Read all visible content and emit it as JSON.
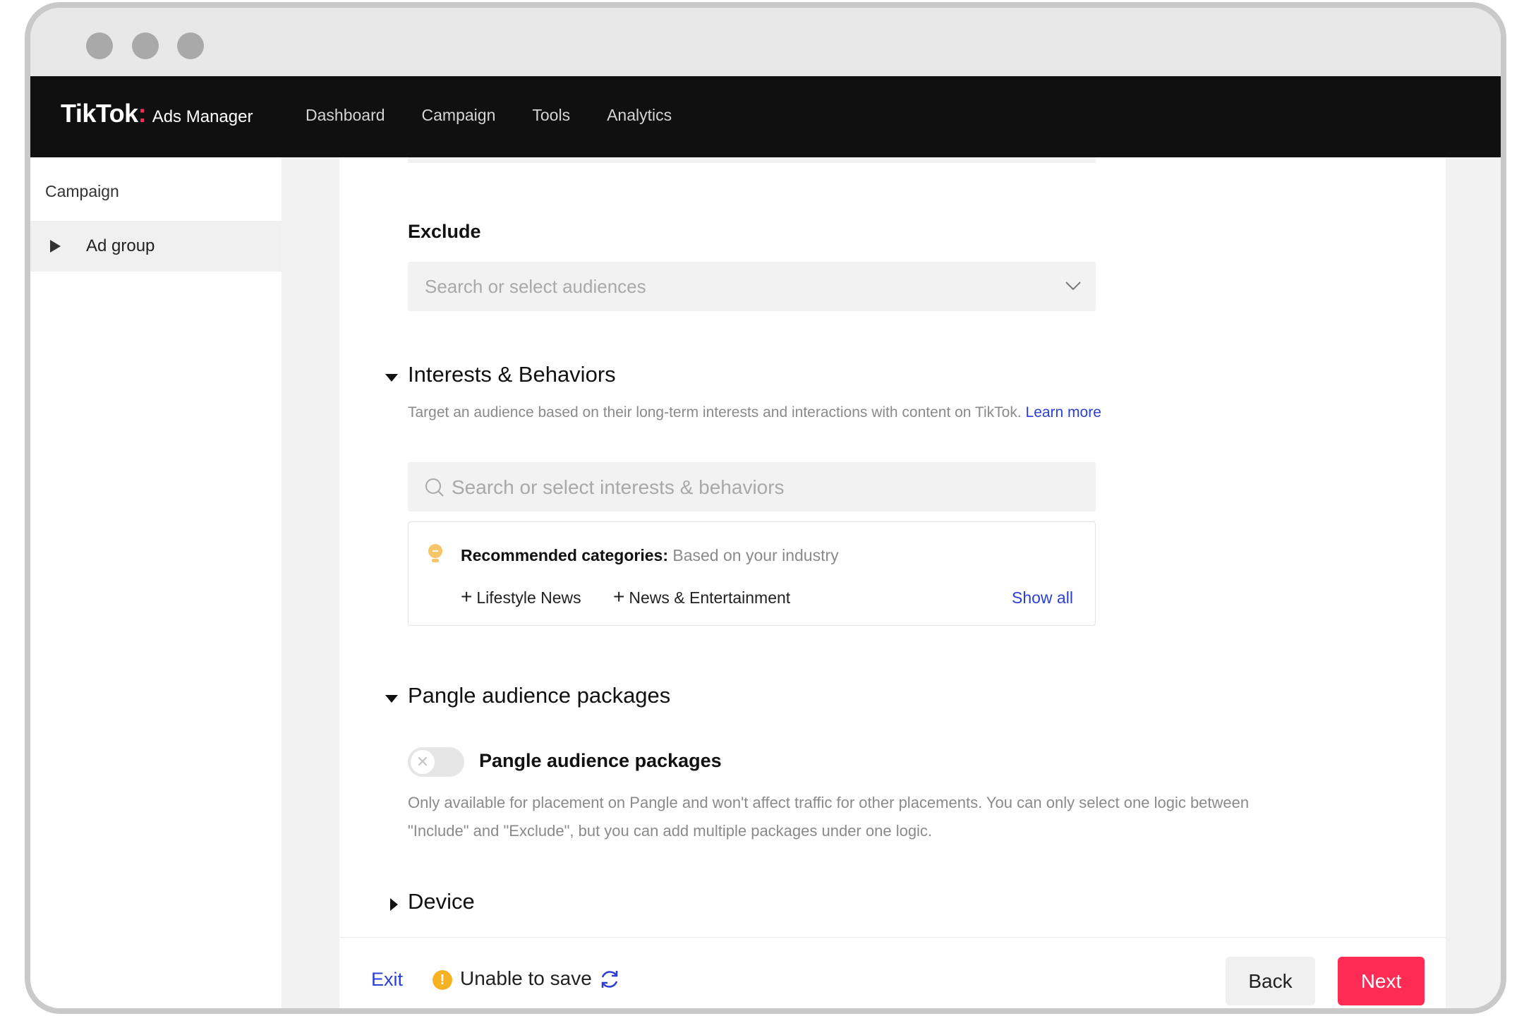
{
  "app": {
    "logo_main": "TikTok",
    "logo_colon": ":",
    "logo_sub": "Ads Manager"
  },
  "nav": {
    "items": [
      {
        "label": "Dashboard"
      },
      {
        "label": "Campaign"
      },
      {
        "label": "Tools"
      },
      {
        "label": "Analytics"
      }
    ]
  },
  "sidebar": {
    "campaign_label": "Campaign",
    "adgroup_label": "Ad group"
  },
  "exclude": {
    "label": "Exclude",
    "placeholder": "Search or select audiences"
  },
  "interests": {
    "title": "Interests & Behaviors",
    "description": "Target an audience based on their long-term interests and interactions with content on TikTok.",
    "learn_more": "Learn more",
    "search_placeholder": "Search or select interests & behaviors",
    "recommended_label": "Recommended categories:",
    "recommended_sub": "Based on your industry",
    "categories": [
      {
        "label": "Lifestyle News"
      },
      {
        "label": "News & Entertainment"
      }
    ],
    "show_all": "Show all"
  },
  "pangle": {
    "title": "Pangle audience packages",
    "toggle_label": "Pangle audience packages",
    "toggle_on": false,
    "description_line1": "Only available for placement on Pangle and won't affect traffic for other placements. You can only select one logic between",
    "description_line2": "\"Include\" and \"Exclude\", but you can add multiple packages under one logic."
  },
  "device": {
    "title": "Device"
  },
  "footer": {
    "exit": "Exit",
    "status": "Unable to save",
    "back": "Back",
    "next": "Next"
  },
  "colors": {
    "accent": "#fe2c55",
    "link": "#2b3fd6",
    "nav_bg": "#101010",
    "warning": "#f5b324"
  }
}
